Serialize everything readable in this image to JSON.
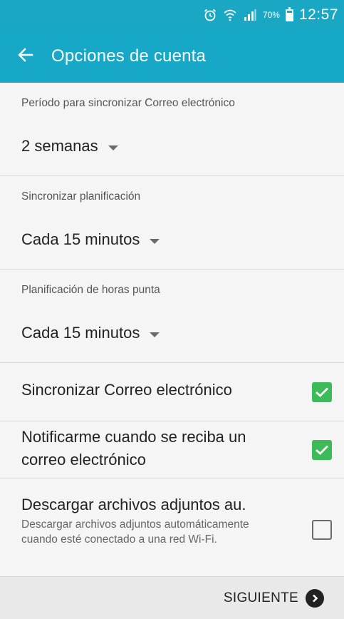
{
  "status_bar": {
    "icons": [
      "alarm-icon",
      "wifi-icon",
      "signal-icon"
    ],
    "battery_percent": "70%",
    "battery_level": 0.7,
    "time": "12:57",
    "background_color": "#19a7c4"
  },
  "app_bar": {
    "back_icon": "arrow-left-icon",
    "title": "Opciones de cuenta",
    "background_color": "#16a8c6"
  },
  "settings": {
    "sync_period": {
      "label": "Período para sincronizar Correo electrónico",
      "value": "2 semanas"
    },
    "sync_schedule": {
      "label": "Sincronizar planificación",
      "value": "Cada 15 minutos"
    },
    "peak_schedule": {
      "label": "Planificación de horas punta",
      "value": "Cada 15 minutos"
    },
    "sync_email": {
      "title": "Sincronizar Correo electrónico",
      "checked": true
    },
    "notify_email": {
      "title": "Notificarme cuando se reciba un correo electrónico",
      "checked": true
    },
    "download_attachments": {
      "title": "Descargar archivos adjuntos au.",
      "subtitle": "Descargar archivos adjuntos automáticamente cuando esté conectado a una red Wi-Fi.",
      "checked": false
    },
    "checkbox_color": "#3dbb5a"
  },
  "footer": {
    "next_label": "SIGUIENTE",
    "next_icon": "chevron-right-circle-icon"
  }
}
